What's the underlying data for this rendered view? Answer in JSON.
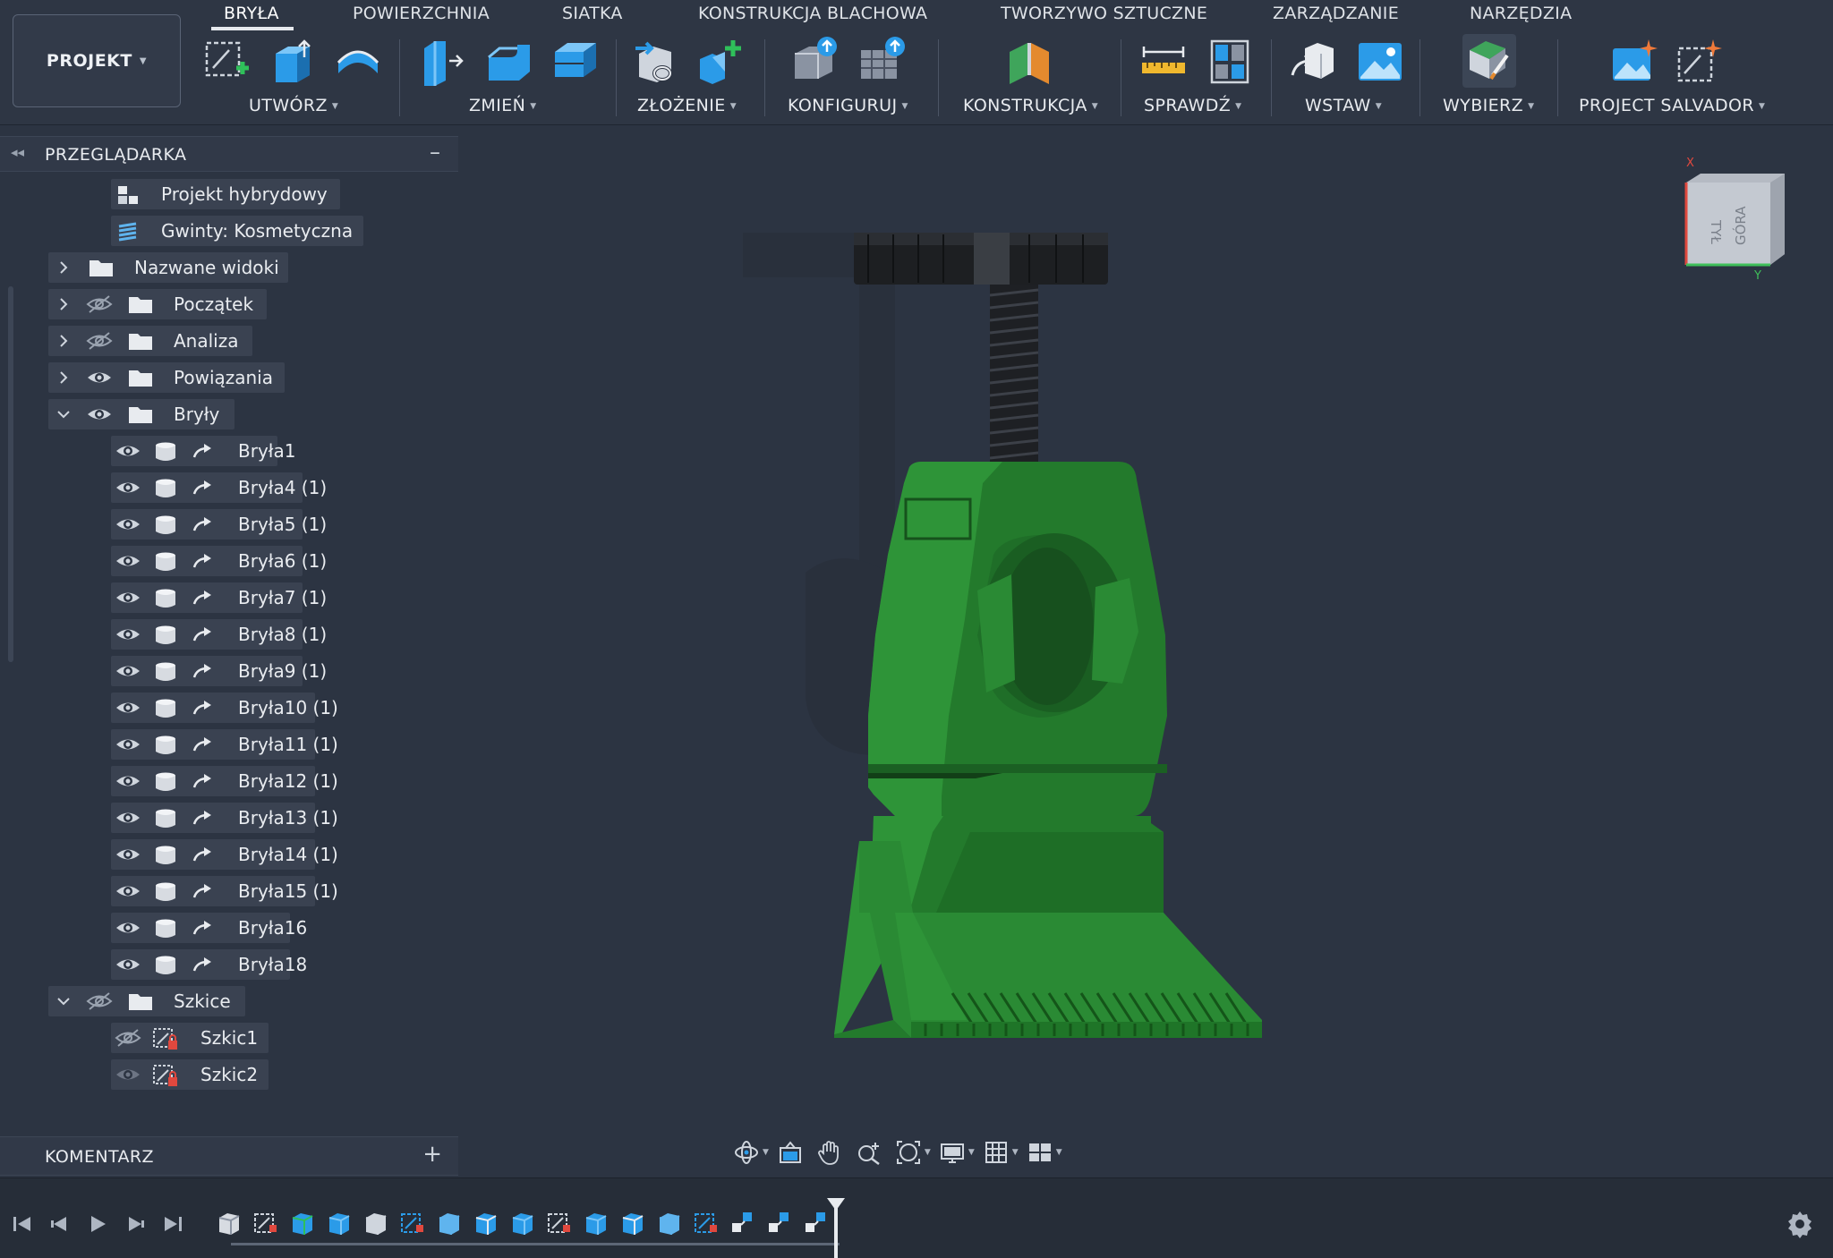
{
  "ribbon": {
    "project_label": "PROJEKT",
    "tabs": [
      "BRYŁA",
      "POWIERZCHNIA",
      "SIATKA",
      "KONSTRUKCJA BLACHOWA",
      "TWORZYWO SZTUCZNE",
      "ZARZĄDZANIE",
      "NARZĘDZIA"
    ],
    "groups": [
      "UTWÓRZ",
      "ZMIEŃ",
      "ZŁOŻENIE",
      "KONFIGURUJ",
      "KONSTRUKCJA",
      "SPRAWDŹ",
      "WSTAW",
      "WYBIERZ",
      "PROJECT SALVADOR"
    ]
  },
  "browser": {
    "title": "PRZEGLĄDARKA",
    "root": [
      {
        "label": "Projekt hybrydowy",
        "icon": "hybrid-design-icon"
      },
      {
        "label": "Gwinty: Kosmetyczna",
        "icon": "thread-icon"
      }
    ],
    "folders": [
      {
        "label": "Nazwane widoki",
        "visible": null,
        "expanded": false
      },
      {
        "label": "Początek",
        "visible": false,
        "expanded": false
      },
      {
        "label": "Analiza",
        "visible": false,
        "expanded": false
      },
      {
        "label": "Powiązania",
        "visible": true,
        "expanded": false
      },
      {
        "label": "Bryły",
        "visible": true,
        "expanded": true
      }
    ],
    "bodies": [
      "Bryła1",
      "Bryła4 (1)",
      "Bryła5 (1)",
      "Bryła6 (1)",
      "Bryła7 (1)",
      "Bryła8 (1)",
      "Bryła9 (1)",
      "Bryła10 (1)",
      "Bryła11 (1)",
      "Bryła12 (1)",
      "Bryła13 (1)",
      "Bryła14 (1)",
      "Bryła15 (1)",
      "Bryła16",
      "Bryła18"
    ],
    "sketch_folder": {
      "label": "Szkice",
      "visible": false,
      "expanded": true
    },
    "sketches": [
      "Szkic1",
      "Szkic2"
    ]
  },
  "comment": {
    "title": "KOMENTARZ"
  },
  "viewcube": {
    "face_top": "GÓRA",
    "face_back": "TYŁ",
    "axis_x": "X",
    "axis_y": "Y"
  },
  "colors": {
    "model_green": "#2e7d32",
    "background": "#2c3442",
    "accent_blue": "#2b9be8"
  }
}
